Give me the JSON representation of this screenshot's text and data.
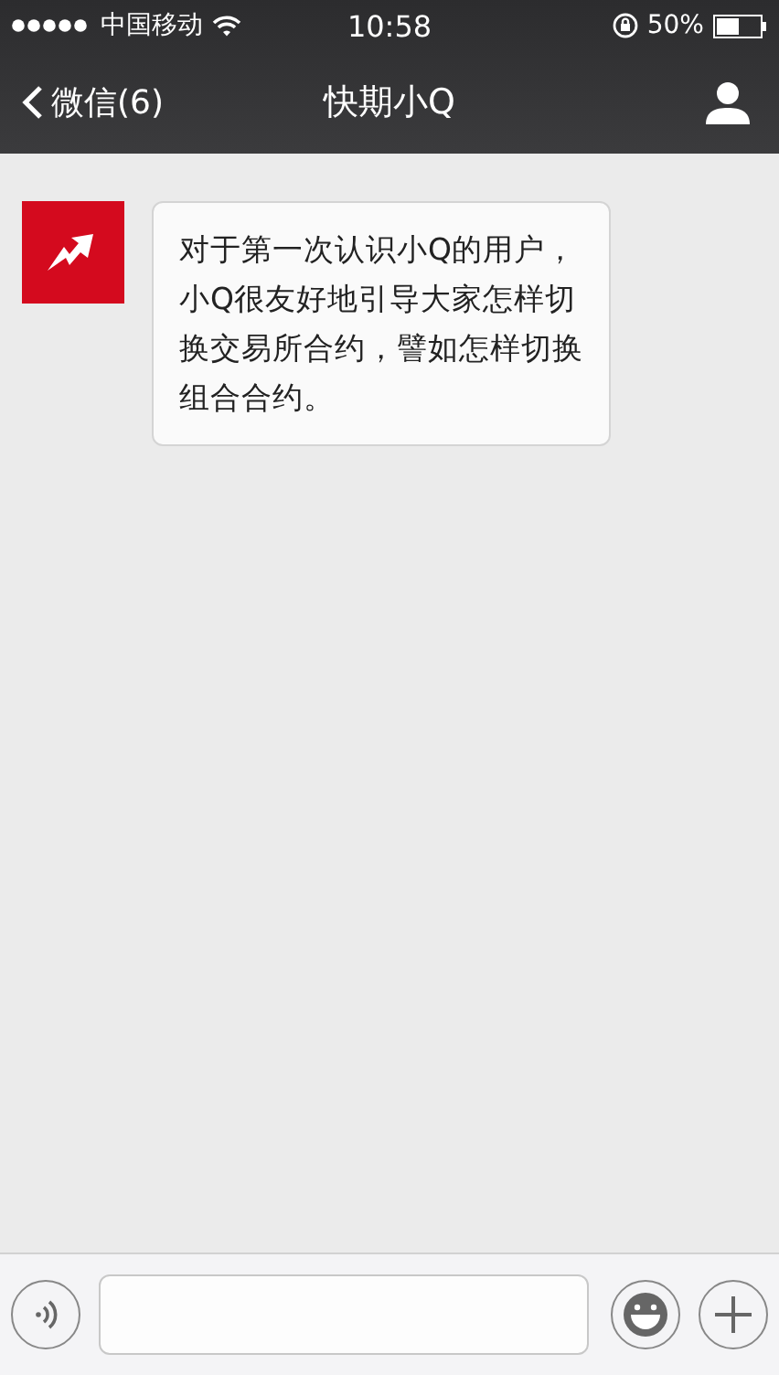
{
  "status_bar": {
    "carrier": "中国移动",
    "time": "10:58",
    "battery": "50%"
  },
  "nav": {
    "back": "微信(6)",
    "title": "快期小Q"
  },
  "messages": [
    {
      "text": "对于第一次认识小Q的用户，小Q很友好地引导大家怎样切换交易所合约，譬如怎样切换组合合约。"
    }
  ]
}
